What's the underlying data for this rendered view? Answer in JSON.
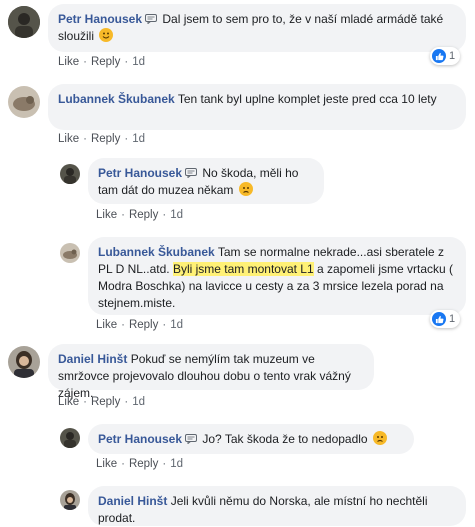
{
  "comments": [
    {
      "author": "Petr Hanousek",
      "text": "Dal jsem to sem pro to, že v naší mladé armádě také sloužili",
      "emoji": "smile-emoji",
      "reactions": "1",
      "like": "Like",
      "reply": "Reply",
      "time": "1d"
    },
    {
      "author": "Lubannek Škubanek",
      "text": "Ten tank byl uplne komplet jeste pred cca 10 lety",
      "like": "Like",
      "reply": "Reply",
      "time": "1d"
    },
    {
      "author": "Petr Hanousek",
      "text": "No škoda, měli ho tam dát do muzea někam",
      "emoji": "sad-emoji",
      "like": "Like",
      "reply": "Reply",
      "time": "1d"
    },
    {
      "author": "Lubannek Škubanek",
      "text_before": "Tam se normalne nekrade...asi sberatele z PL D NL..atd.",
      "text_highlight": "Byli jsme tam montovat L1",
      "text_after": "a zapomeli jsme vrtacku ( Modra Boschka) na lavicce u cesty a za 3 mrsice lezela porad na stejnem.miste.",
      "reactions": "1",
      "like": "Like",
      "reply": "Reply",
      "time": "1d"
    },
    {
      "author": "Daniel Hinšt",
      "text": "Pokuď se nemýlím tak muzeum ve smržovce projevovalo dlouhou dobu o tento vrak vážný zájem.",
      "like": "Like",
      "reply": "Reply",
      "time": "1d"
    },
    {
      "author": "Petr Hanousek",
      "text": "Jo? Tak škoda že to nedopadlo",
      "emoji": "sad-emoji",
      "like": "Like",
      "reply": "Reply",
      "time": "1d"
    },
    {
      "author": "Daniel Hinšt",
      "text": "Jeli kvůli němu do Norska, ale místní ho nechtěli prodat."
    }
  ],
  "colors": {
    "author": "#385898",
    "bubble": "#f2f3f5",
    "like_blue": "#1877f2",
    "highlight": "#fff176"
  }
}
